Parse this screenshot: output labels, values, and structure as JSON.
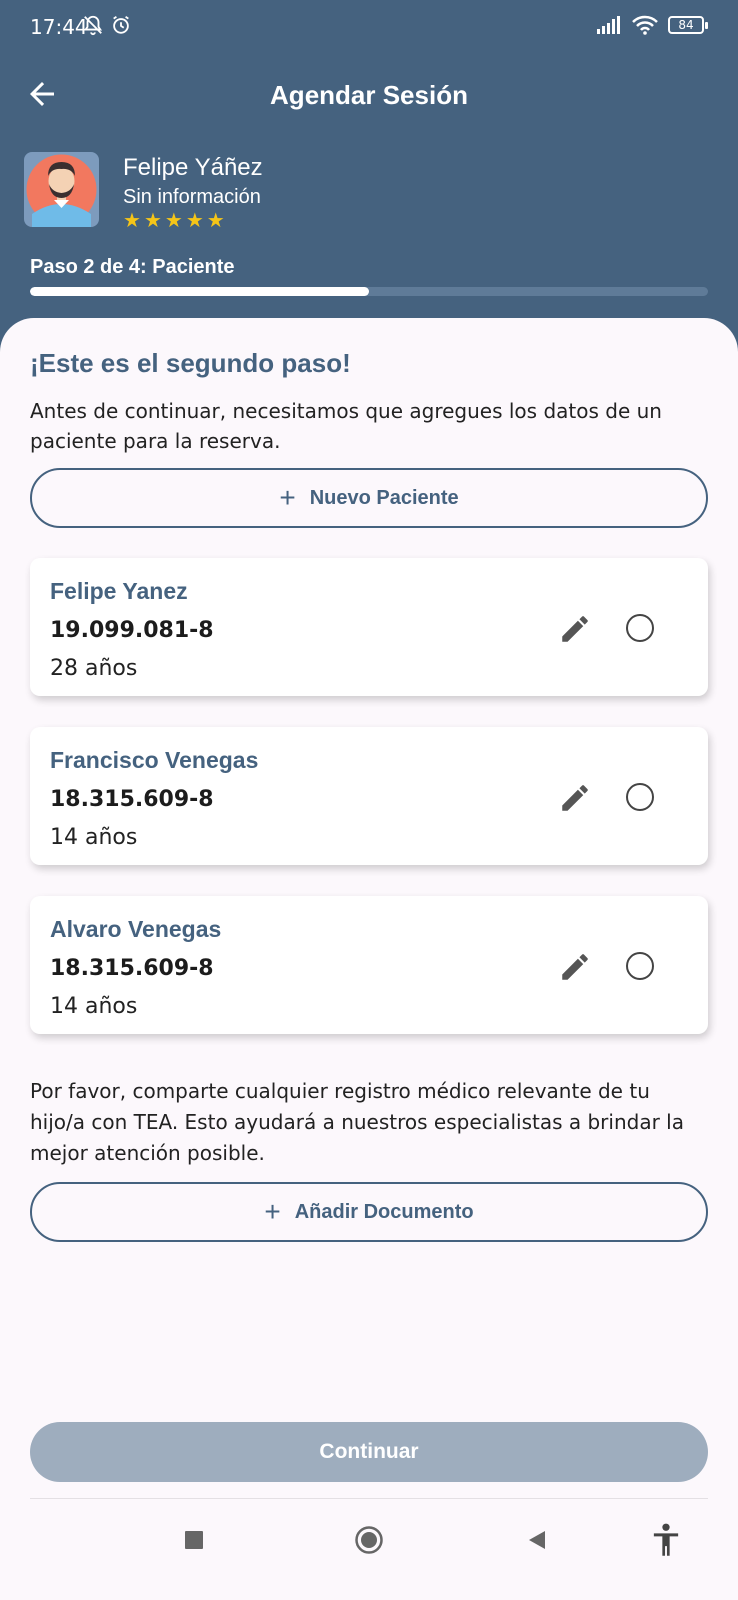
{
  "status_bar": {
    "time": "17:44",
    "battery": "84"
  },
  "app_bar": {
    "title": "Agendar Sesión"
  },
  "profile": {
    "name": "Felipe Yáñez",
    "info": "Sin información",
    "rating": 5
  },
  "stepper": {
    "label": "Paso 2 de 4: Paciente",
    "progress": 0.5
  },
  "content": {
    "heading": "¡Este es el segundo paso!",
    "intro": "Antes de continuar, necesitamos que agregues los datos de un paciente para la reserva.",
    "new_patient_label": "Nuevo Paciente",
    "patients": [
      {
        "name": "Felipe Yanez",
        "id": "19.099.081-8",
        "age": "28 años"
      },
      {
        "name": "Francisco Venegas",
        "id": "18.315.609-8",
        "age": "14 años"
      },
      {
        "name": "Alvaro Venegas",
        "id": "18.315.609-8",
        "age": "14 años"
      }
    ],
    "note": "Por favor, comparte cualquier registro médico relevante de tu hijo/a con TEA. Esto ayudará a nuestros especialistas a brindar la mejor atención posible.",
    "add_document_label": "Añadir Documento",
    "continue_label": "Continuar"
  },
  "colors": {
    "primary": "#45627f",
    "sheet": "#fcf8fc",
    "star": "#f5c518",
    "disabled": "#9eadbe"
  }
}
